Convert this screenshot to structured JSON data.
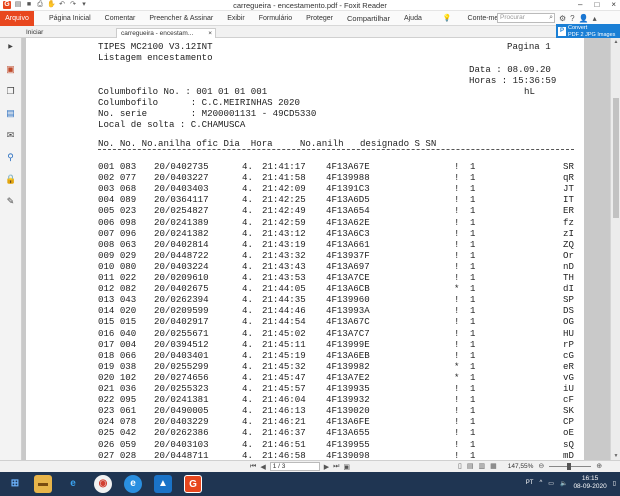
{
  "window": {
    "title": "carregueira - encestamento.pdf - Foxit Reader",
    "controls": [
      "–",
      "□",
      "×"
    ]
  },
  "ribbon": {
    "file_tab": "Arquivo",
    "menus": [
      "Página Inicial",
      "Comentar",
      "Preencher & Assinar",
      "Exibir",
      "Formulário",
      "Proteger",
      "Compartilhar",
      "Ajuda"
    ],
    "tell_me": "Conte-me...",
    "search_placeholder": "Procurar"
  },
  "tabs": {
    "start": "Iniciar",
    "active": "carregueira - encestam..."
  },
  "promo": {
    "line1": "Convert",
    "line2": "PDF 2 JPG Images"
  },
  "document": {
    "header_left_1": "TIPES MC2100 V3.12INT",
    "header_left_2": "Listagem encestamento",
    "header_page": "Pagina 1",
    "date": "Data : 08.09.20",
    "hours": "Horas : 15:36:59",
    "hl": "hL",
    "columbofilo_no": "Columbofilo No. : 001 01 01 001",
    "columbofilo": "Columbofilo      : C.C.MEIRINHAS 2020",
    "no_serie": "No. serie        : M200001131 - 49CD5330",
    "local_solta": "Local de solta : C.CHAMUSCA",
    "col_header": "No. No. No.anilha ofic Dia  Hora     No.anilh   designado S SN",
    "rows": [
      [
        "001 083",
        "20/0402735",
        "4.",
        "21:41:17",
        "4F13A67E",
        "!",
        "1",
        "SR"
      ],
      [
        "002 077",
        "20/0403227",
        "4.",
        "21:41:58",
        "4F139988",
        "!",
        "1",
        "qR"
      ],
      [
        "003 068",
        "20/0403403",
        "4.",
        "21:42:09",
        "4F1391C3",
        "!",
        "1",
        "JT"
      ],
      [
        "004 089",
        "20/0364117",
        "4.",
        "21:42:25",
        "4F13A6D5",
        "!",
        "1",
        "IT"
      ],
      [
        "005 023",
        "20/0254827",
        "4.",
        "21:42:49",
        "4F13A654",
        "!",
        "1",
        "ER"
      ],
      [
        "006 098",
        "20/0241389",
        "4.",
        "21:42:59",
        "4F13A62E",
        "!",
        "1",
        "fz"
      ],
      [
        "007 096",
        "20/0241382",
        "4.",
        "21:43:12",
        "4F13A6C3",
        "!",
        "1",
        "zI"
      ],
      [
        "008 063",
        "20/0402814",
        "4.",
        "21:43:19",
        "4F13A661",
        "!",
        "1",
        "ZQ"
      ],
      [
        "009 029",
        "20/0448722",
        "4.",
        "21:43:32",
        "4F13937F",
        "!",
        "1",
        "Or"
      ],
      [
        "010 080",
        "20/0403224",
        "4.",
        "21:43:43",
        "4F13A697",
        "!",
        "1",
        "nD"
      ],
      [
        "011 022",
        "20/0209610",
        "4.",
        "21:43:53",
        "4F13A7CE",
        "!",
        "1",
        "TH"
      ],
      [
        "012 082",
        "20/0402675",
        "4.",
        "21:44:05",
        "4F13A6CB",
        "*",
        "1",
        "dI"
      ],
      [
        "013 043",
        "20/0262394",
        "4.",
        "21:44:35",
        "4F139960",
        "!",
        "1",
        "SP"
      ],
      [
        "014 020",
        "20/0209599",
        "4.",
        "21:44:46",
        "4F13993A",
        "!",
        "1",
        "DS"
      ],
      [
        "015 015",
        "20/0402917",
        "4.",
        "21:44:54",
        "4F13A67C",
        "!",
        "1",
        "OG"
      ],
      [
        "016 040",
        "20/0255671",
        "4.",
        "21:45:02",
        "4F13A7C7",
        "!",
        "1",
        "HU"
      ],
      [
        "017 004",
        "20/0394512",
        "4.",
        "21:45:11",
        "4F13999E",
        "!",
        "1",
        "rP"
      ],
      [
        "018 066",
        "20/0403401",
        "4.",
        "21:45:19",
        "4F13A6EB",
        "!",
        "1",
        "cG"
      ],
      [
        "019 038",
        "20/0255299",
        "4.",
        "21:45:32",
        "4F139982",
        "*",
        "1",
        "eR"
      ],
      [
        "020 102",
        "20/0274656",
        "4.",
        "21:45:47",
        "4F13A7E2",
        "*",
        "1",
        "vG"
      ],
      [
        "021 036",
        "20/0255323",
        "4.",
        "21:45:57",
        "4F139935",
        "!",
        "1",
        "iU"
      ],
      [
        "022 095",
        "20/0241381",
        "4.",
        "21:46:04",
        "4F139932",
        "!",
        "1",
        "cF"
      ],
      [
        "023 061",
        "20/0490005",
        "4.",
        "21:46:13",
        "4F139020",
        "!",
        "1",
        "SK"
      ],
      [
        "024 078",
        "20/0403229",
        "4.",
        "21:46:21",
        "4F13A6FE",
        "!",
        "1",
        "CP"
      ],
      [
        "025 042",
        "20/0262386",
        "4.",
        "21:46:37",
        "4F13A655",
        "!",
        "1",
        "oE"
      ],
      [
        "026 059",
        "20/0403103",
        "4.",
        "21:46:51",
        "4F139955",
        "!",
        "1",
        "sQ"
      ],
      [
        "027 028",
        "20/0448711",
        "4.",
        "21:46:58",
        "4F139098",
        "!",
        "1",
        "mD"
      ],
      [
        "028 001",
        "20/0400014",
        "4.",
        "21:47:07",
        "4F13A61B",
        "!",
        "1",
        "pS"
      ],
      [
        "029 005",
        "20/0394513",
        "4.",
        "21:47:21",
        "4F13A7E3",
        "!",
        "1",
        "DA"
      ]
    ]
  },
  "statusbar": {
    "page_indicator": "1 / 3",
    "zoom": "147,55%"
  },
  "taskbar": {
    "lang": "PT",
    "time": "16:15",
    "date": "08-09-2020"
  }
}
